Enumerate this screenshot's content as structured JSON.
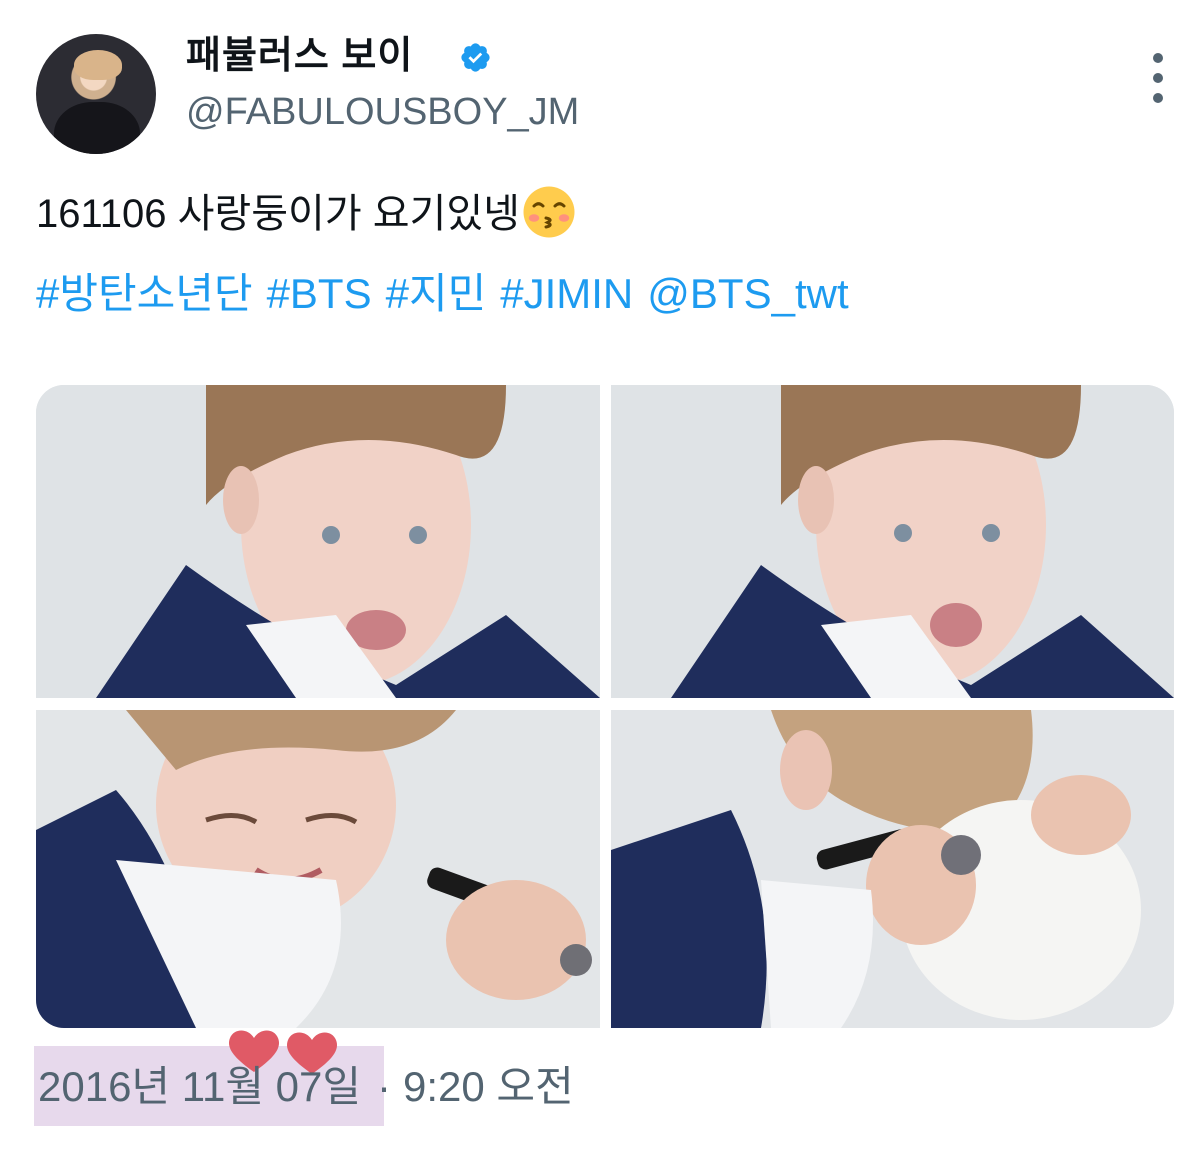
{
  "tweet": {
    "author": {
      "display_name": "패뷸러스 보이",
      "handle": "@FABULOUSBOY_JM",
      "verified": true,
      "verified_icon": "verified-badge-icon",
      "avatar": "profile avatar"
    },
    "more_icon": "more-options-icon",
    "text": "161106 사랑둥이가 요기있넹",
    "text_emoji": "kissing-face-emoji",
    "tags": [
      "#방탄소년단",
      "#BTS",
      "#지민",
      "#JIMIN",
      "@BTS_twt"
    ],
    "media": [
      {
        "alt": "photo 1"
      },
      {
        "alt": "photo 2"
      },
      {
        "alt": "photo 3"
      },
      {
        "alt": "photo 4"
      }
    ],
    "timestamp": {
      "date": "2016년 11월 07일",
      "separator": "·",
      "time": "9:20 오전"
    },
    "decoration": "hearts-sticker",
    "colors": {
      "link": "#1d9bf0",
      "secondary_text": "#536471",
      "date_highlight": "#e7d9ec",
      "heart": "#e05a66"
    }
  }
}
